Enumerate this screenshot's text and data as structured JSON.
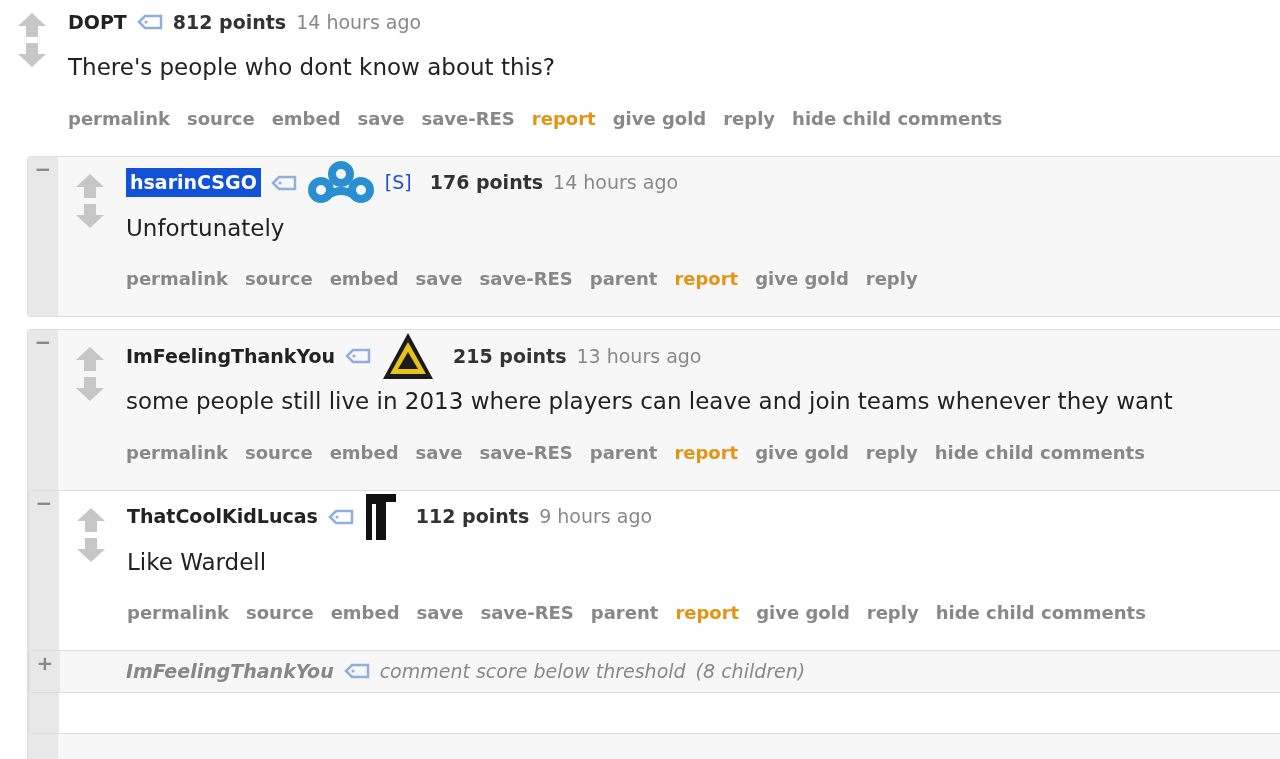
{
  "comments": [
    {
      "author": "DOPT",
      "highlighted": false,
      "points": "812 points",
      "time": "14 hours ago",
      "body": "There's people who dont know about this?",
      "actions": [
        {
          "label": "permalink",
          "kind": "link"
        },
        {
          "label": "source",
          "kind": "link"
        },
        {
          "label": "embed",
          "kind": "link"
        },
        {
          "label": "save",
          "kind": "link"
        },
        {
          "label": "save-RES",
          "kind": "link"
        },
        {
          "label": "report",
          "kind": "report"
        },
        {
          "label": "give gold",
          "kind": "link"
        },
        {
          "label": "reply",
          "kind": "link"
        },
        {
          "label": "hide child comments",
          "kind": "link"
        }
      ],
      "children": [
        {
          "kind": "full",
          "toggle": "−",
          "author": "hsarinCSGO",
          "highlighted": true,
          "flair": {
            "kind": "cloud"
          },
          "submitter": "[S]",
          "points": "176 points",
          "time": "14 hours ago",
          "body": "Unfortunately",
          "actions": [
            {
              "label": "permalink",
              "kind": "link"
            },
            {
              "label": "source",
              "kind": "link"
            },
            {
              "label": "embed",
              "kind": "link"
            },
            {
              "label": "save",
              "kind": "link"
            },
            {
              "label": "save-RES",
              "kind": "link"
            },
            {
              "label": "parent",
              "kind": "link"
            },
            {
              "label": "report",
              "kind": "report"
            },
            {
              "label": "give gold",
              "kind": "link"
            },
            {
              "label": "reply",
              "kind": "link"
            }
          ]
        },
        {
          "kind": "full",
          "toggle": "−",
          "author": "ImFeelingThankYou",
          "highlighted": false,
          "flair": {
            "kind": "triangle"
          },
          "points": "215 points",
          "time": "13 hours ago",
          "body": "some people still live in 2013 where players can leave and join teams whenever they want",
          "actions": [
            {
              "label": "permalink",
              "kind": "link"
            },
            {
              "label": "source",
              "kind": "link"
            },
            {
              "label": "embed",
              "kind": "link"
            },
            {
              "label": "save",
              "kind": "link"
            },
            {
              "label": "save-RES",
              "kind": "link"
            },
            {
              "label": "parent",
              "kind": "link"
            },
            {
              "label": "report",
              "kind": "report"
            },
            {
              "label": "give gold",
              "kind": "link"
            },
            {
              "label": "reply",
              "kind": "link"
            },
            {
              "label": "hide child comments",
              "kind": "link"
            }
          ],
          "children": [
            {
              "kind": "full",
              "toggle": "−",
              "author": "ThatCoolKidLucas",
              "highlighted": false,
              "flair": {
                "kind": "logo"
              },
              "points": "112 points",
              "time": "9 hours ago",
              "body": "Like Wardell",
              "actions": [
                {
                  "label": "permalink",
                  "kind": "link"
                },
                {
                  "label": "source",
                  "kind": "link"
                },
                {
                  "label": "embed",
                  "kind": "link"
                },
                {
                  "label": "save",
                  "kind": "link"
                },
                {
                  "label": "save-RES",
                  "kind": "link"
                },
                {
                  "label": "parent",
                  "kind": "link"
                },
                {
                  "label": "report",
                  "kind": "report"
                },
                {
                  "label": "give gold",
                  "kind": "link"
                },
                {
                  "label": "reply",
                  "kind": "link"
                },
                {
                  "label": "hide child comments",
                  "kind": "link"
                }
              ],
              "children": [
                {
                  "kind": "collapsed",
                  "toggle": "+",
                  "author": "ImFeelingThankYou",
                  "note": "comment score below threshold",
                  "count": "(8 children)"
                }
              ]
            }
          ]
        }
      ]
    }
  ]
}
